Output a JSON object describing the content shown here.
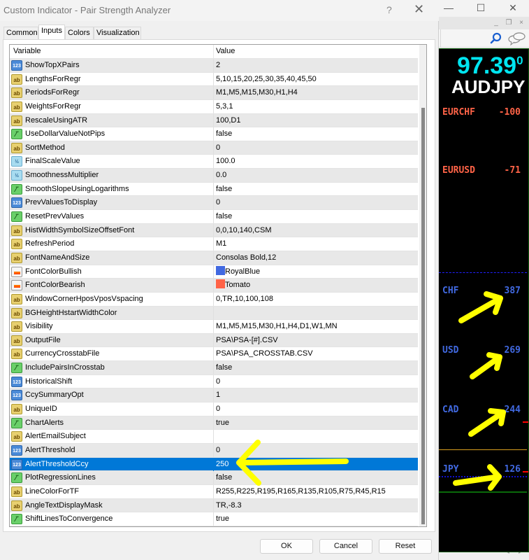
{
  "dialog": {
    "title": "Custom Indicator - Pair Strength Analyzer",
    "help_label": "?",
    "close_label": "✕",
    "tabs": [
      {
        "label": "Common",
        "active": false
      },
      {
        "label": "Inputs",
        "active": true
      },
      {
        "label": "Colors",
        "active": false
      },
      {
        "label": "Visualization",
        "active": false
      }
    ],
    "columns": {
      "variable": "Variable",
      "value": "Value"
    },
    "rows": [
      {
        "type": "int",
        "icon": "123",
        "name": "ShowTopXPairs",
        "value": "2"
      },
      {
        "type": "str",
        "icon": "ab",
        "name": "LengthsForRegr",
        "value": "5,10,15,20,25,30,35,40,45,50"
      },
      {
        "type": "str",
        "icon": "ab",
        "name": "PeriodsForRegr",
        "value": "M1,M5,M15,M30,H1,H4"
      },
      {
        "type": "str",
        "icon": "ab",
        "name": "WeightsForRegr",
        "value": "5,3,1"
      },
      {
        "type": "str",
        "icon": "ab",
        "name": "RescaleUsingATR",
        "value": "100,D1"
      },
      {
        "type": "bool",
        "icon": "⁄‾",
        "name": "UseDollarValueNotPips",
        "value": "false"
      },
      {
        "type": "str",
        "icon": "ab",
        "name": "SortMethod",
        "value": "0"
      },
      {
        "type": "dbl",
        "icon": "½",
        "name": "FinalScaleValue",
        "value": "100.0"
      },
      {
        "type": "dbl",
        "icon": "½",
        "name": "SmoothnessMultiplier",
        "value": "0.0"
      },
      {
        "type": "bool",
        "icon": "⁄‾",
        "name": "SmoothSlopeUsingLogarithms",
        "value": "false"
      },
      {
        "type": "int",
        "icon": "123",
        "name": "PrevValuesToDisplay",
        "value": "0"
      },
      {
        "type": "bool",
        "icon": "⁄‾",
        "name": "ResetPrevValues",
        "value": "false"
      },
      {
        "type": "str",
        "icon": "ab",
        "name": "HistWidthSymbolSizeOffsetFont",
        "value": "0,0,10,140,CSM"
      },
      {
        "type": "str",
        "icon": "ab",
        "name": "RefreshPeriod",
        "value": "M1"
      },
      {
        "type": "str",
        "icon": "ab",
        "name": "FontNameAndSize",
        "value": "Consolas Bold,12"
      },
      {
        "type": "clr",
        "icon": "",
        "name": "FontColorBullish",
        "value": "RoyalBlue",
        "swatch": "#4169e1"
      },
      {
        "type": "clr",
        "icon": "",
        "name": "FontColorBearish",
        "value": "Tomato",
        "swatch": "#ff6347"
      },
      {
        "type": "str",
        "icon": "ab",
        "name": "WindowCornerHposVposVspacing",
        "value": "0,TR,10,100,108"
      },
      {
        "type": "str",
        "icon": "ab",
        "name": "BGHeightHstartWidthColor",
        "value": ""
      },
      {
        "type": "str",
        "icon": "ab",
        "name": "Visibility",
        "value": "M1,M5,M15,M30,H1,H4,D1,W1,MN"
      },
      {
        "type": "str",
        "icon": "ab",
        "name": "OutputFile",
        "value": "PSA\\PSA-[#].CSV"
      },
      {
        "type": "str",
        "icon": "ab",
        "name": "CurrencyCrosstabFile",
        "value": "PSA\\PSA_CROSSTAB.CSV"
      },
      {
        "type": "bool",
        "icon": "⁄‾",
        "name": "IncludePairsInCrosstab",
        "value": "false"
      },
      {
        "type": "int",
        "icon": "123",
        "name": "HistoricalShift",
        "value": "0"
      },
      {
        "type": "int",
        "icon": "123",
        "name": "CcySummaryOpt",
        "value": "1"
      },
      {
        "type": "str",
        "icon": "ab",
        "name": "UniqueID",
        "value": "0"
      },
      {
        "type": "bool",
        "icon": "⁄‾",
        "name": "ChartAlerts",
        "value": "true"
      },
      {
        "type": "str",
        "icon": "ab",
        "name": "AlertEmailSubject",
        "value": ""
      },
      {
        "type": "int",
        "icon": "123",
        "name": "AlertThreshold",
        "value": "0"
      },
      {
        "type": "int",
        "icon": "123",
        "name": "AlertThresholdCcy",
        "value": "250",
        "selected": true
      },
      {
        "type": "bool",
        "icon": "⁄‾",
        "name": "PlotRegressionLines",
        "value": "false"
      },
      {
        "type": "str",
        "icon": "ab",
        "name": "LineColorForTF",
        "value": "R255,R225,R195,R165,R135,R105,R75,R45,R15"
      },
      {
        "type": "str",
        "icon": "ab",
        "name": "AngleTextDisplayMask",
        "value": "TR,-8.3"
      },
      {
        "type": "bool",
        "icon": "⁄‾",
        "name": "ShiftLinesToConvergence",
        "value": "true"
      }
    ],
    "buttons": {
      "ok": "OK",
      "cancel": "Cancel",
      "reset": "Reset"
    }
  },
  "background_window": {
    "window_controls": {
      "minimize": "—",
      "maximize": "☐",
      "close": "✕"
    },
    "mdi_controls": {
      "minimize": "_",
      "restore": "❐",
      "close": "×"
    },
    "chart": {
      "price": "97.39",
      "price_sup": "0",
      "symbol": "AUDJPY",
      "pairs": [
        {
          "name": "EURCHF",
          "value": "-100",
          "sentiment": "bearish"
        },
        {
          "name": "EURUSD",
          "value": "-71",
          "sentiment": "bearish"
        }
      ],
      "currencies": [
        {
          "name": "CHF",
          "value": "387",
          "sentiment": "bullish"
        },
        {
          "name": "USD",
          "value": "269",
          "sentiment": "bullish"
        },
        {
          "name": "CAD",
          "value": "244",
          "sentiment": "bullish"
        },
        {
          "name": "JPY",
          "value": "126",
          "sentiment": "bullish"
        }
      ],
      "colors": {
        "price": "#00e5f0",
        "bearish": "#ff6347",
        "bullish": "#4169e1",
        "annotation": "#ffff00"
      }
    }
  }
}
